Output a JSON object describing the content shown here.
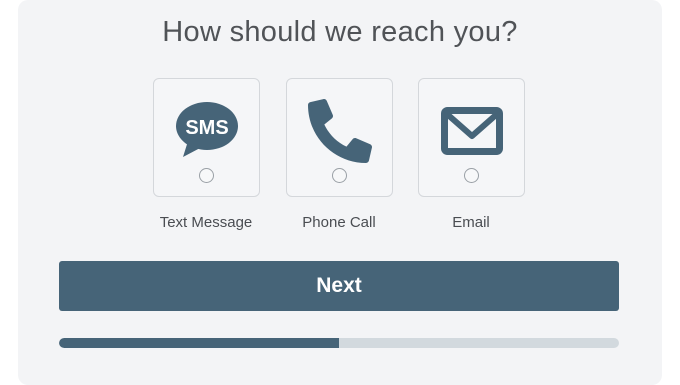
{
  "title": "How should we reach you?",
  "options": [
    {
      "label": "Text Message",
      "icon": "sms-bubble-icon",
      "icon_text": "SMS",
      "selected": false
    },
    {
      "label": "Phone Call",
      "icon": "phone-icon",
      "selected": false
    },
    {
      "label": "Email",
      "icon": "envelope-icon",
      "selected": false
    }
  ],
  "next_button": {
    "label": "Next"
  },
  "progress": {
    "percent": 50
  },
  "colors": {
    "accent": "#466478",
    "progress_track": "#d2d9de",
    "background": "#f3f4f6"
  }
}
